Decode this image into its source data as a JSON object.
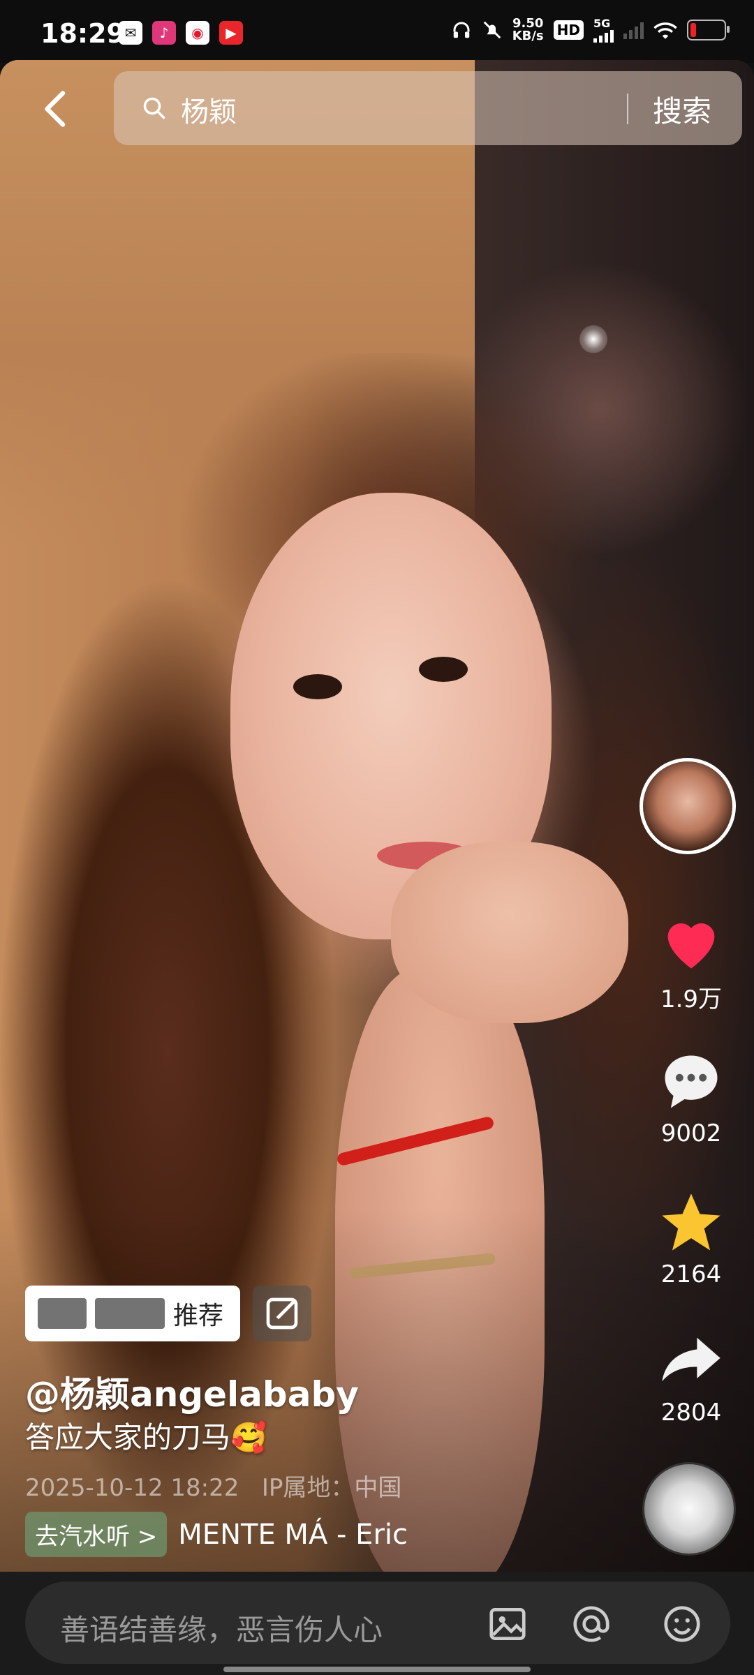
{
  "status_bar": {
    "time": "18:29",
    "net_speed_value": "9.50",
    "net_speed_unit": "KB/s",
    "hd_label": "HD",
    "network": "5G",
    "app_icons": [
      "wechat-icon",
      "music-app-icon",
      "weibo-icon",
      "video-app-icon"
    ]
  },
  "search": {
    "query": "杨颖",
    "button_label": "搜索"
  },
  "rail": {
    "likes": "1.9万",
    "comments": "9002",
    "favorites": "2164",
    "shares": "2804",
    "like_color": "#fe2c55",
    "favorite_color": "#fbc531"
  },
  "post": {
    "recommend_label": "推荐",
    "author": "@杨颖angelababy",
    "caption": "答应大家的刀马🥰",
    "date": "2025-10-12 18:22",
    "ip_label": "IP属地：中国",
    "music_tag": "去汽水听 >",
    "music_name": "MENTE MÁ - Eric"
  },
  "comment_bar": {
    "placeholder": "善语结善缘，恶言伤人心"
  }
}
